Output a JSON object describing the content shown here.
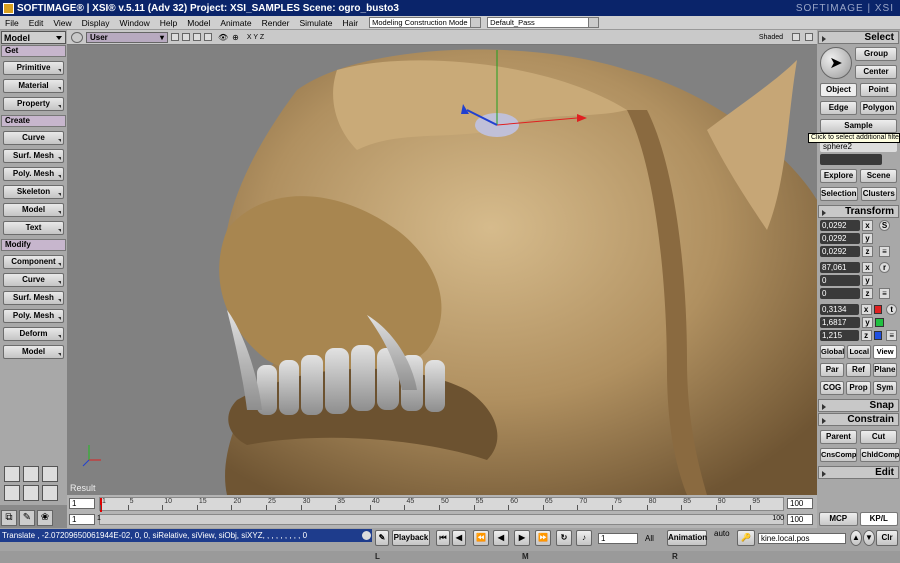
{
  "window": {
    "title": "SOFTIMAGE® | XSI® v.5.11 (Adv 32) Project: XSI_SAMPLES     Scene: ogro_busto3",
    "brand": "SOFTIMAGE | XSI"
  },
  "menubar": {
    "items": [
      "File",
      "Edit",
      "View",
      "Display",
      "Window",
      "Help",
      "Model",
      "Animate",
      "Render",
      "Simulate",
      "Hair"
    ],
    "construction_mode": "Modeling Construction Mode",
    "pass": "Default_Pass"
  },
  "left_panel": {
    "mode": "Model",
    "sections": [
      {
        "header": "Get",
        "buttons": [
          "Primitive",
          "Material",
          "Property"
        ]
      },
      {
        "header": "Create",
        "buttons": [
          "Curve",
          "Surf. Mesh",
          "Poly. Mesh",
          "Skeleton",
          "Model",
          "Text"
        ]
      },
      {
        "header": "Modify",
        "buttons": [
          "Component",
          "Curve",
          "Surf. Mesh",
          "Poly. Mesh",
          "Deform",
          "Model"
        ]
      }
    ]
  },
  "viewport": {
    "camera": "User",
    "axes_label": "X Y Z",
    "shading": "Shaded",
    "result_label": "Result",
    "colors": {
      "skin": "#b09060",
      "skin_dark": "#6f5533",
      "teeth": "#a8a8a8",
      "bg": "#818181"
    }
  },
  "right_panel": {
    "select_header": "Select",
    "select_buttons": {
      "group": "Group",
      "center": "Center",
      "object": "Object",
      "point": "Point",
      "edge": "Edge",
      "polygon": "Polygon"
    },
    "sample": "Sample",
    "tooltip": "Click to select additional filter",
    "selected_name": "sphere2",
    "explore": "Explore",
    "scene": "Scene",
    "selection": "Selection",
    "clusters": "Clusters",
    "transform_header": "Transform",
    "scale": [
      "0,0292",
      "0,0292",
      "0,0292"
    ],
    "rotation": [
      "87,061",
      "0",
      "0"
    ],
    "translation": [
      "0,3134",
      "1,6817",
      "1,215"
    ],
    "axis_labels": [
      "x",
      "y",
      "z"
    ],
    "scale_icon": "S",
    "rot_icon": "r",
    "trans_icon": "t",
    "space_buttons": [
      "Global",
      "Local",
      "View"
    ],
    "pivot_buttons": [
      "Par",
      "Ref",
      "Plane"
    ],
    "cog_buttons": [
      "COG",
      "Prop",
      "Sym"
    ],
    "snap_header": "Snap",
    "constrain_header": "Constrain",
    "constrain_buttons": [
      "Parent",
      "Cut",
      "CnsComp",
      "ChldComp"
    ],
    "edit_header": "Edit",
    "bottom_tabs": [
      "MCP",
      "KP/L"
    ]
  },
  "timeline": {
    "start": "1",
    "start2": "1",
    "ticks": [
      "1",
      "5",
      "10",
      "15",
      "20",
      "25",
      "30",
      "35",
      "40",
      "45",
      "50",
      "55",
      "60",
      "65",
      "70",
      "75",
      "80",
      "85",
      "90",
      "95"
    ],
    "end": "100",
    "end2": "100",
    "end_inner": "100"
  },
  "statusbar": {
    "command": "Translate , -2.07209650061944E-02, 0, 0, siRelative, siView, siObj, siXYZ, , , , , , , , , 0",
    "playback": "Playback",
    "frame": "1",
    "all": "All",
    "animation": "Animation",
    "auto": "auto",
    "param": "kine.local.pos",
    "clr": "Clr",
    "mouse_keys": [
      "L",
      "M",
      "R"
    ]
  }
}
